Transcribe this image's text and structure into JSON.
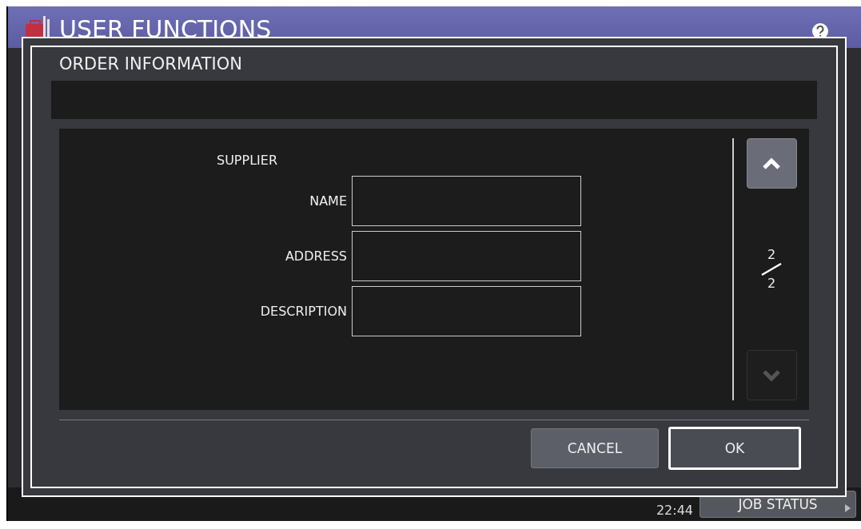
{
  "header": {
    "title": "USER FUNCTIONS"
  },
  "dialog": {
    "title": "ORDER INFORMATION",
    "section": "SUPPLIER",
    "fields": [
      {
        "label": "NAME"
      },
      {
        "label": "ADDRESS"
      },
      {
        "label": "DESCRIPTION"
      }
    ],
    "pager": {
      "current": "2",
      "total": "2",
      "up_disabled": false,
      "down_disabled": true
    },
    "buttons": [
      {
        "label": "CANCEL",
        "default": false
      },
      {
        "label": "OK",
        "default": true
      }
    ]
  },
  "status_bar": {
    "time": "22:44",
    "job_status": "JOB STATUS"
  }
}
